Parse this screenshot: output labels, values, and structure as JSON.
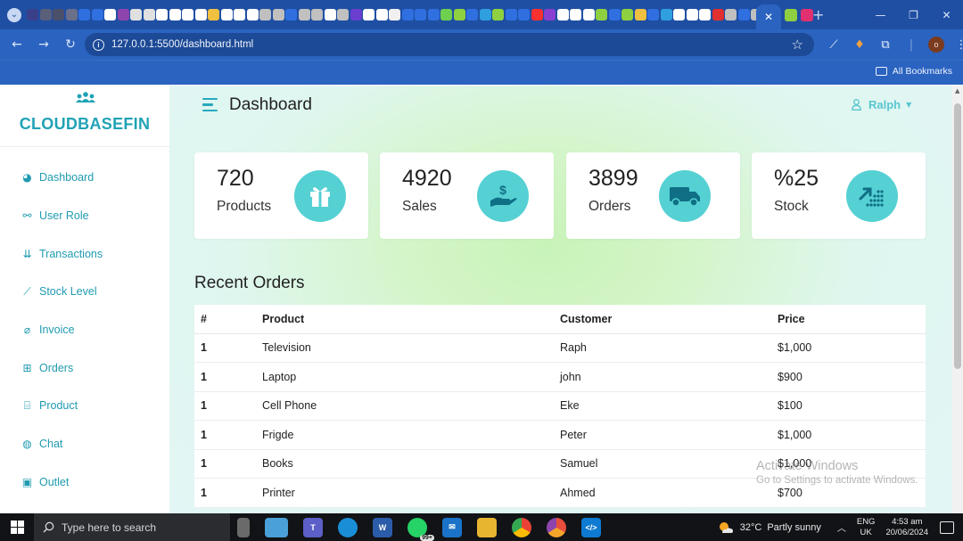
{
  "browser": {
    "url": "127.0.0.1:5500/dashboard.html",
    "all_bookmarks_label": "All Bookmarks",
    "profile_initial": "o",
    "tab_icon_colors": [
      "#3a3f8a",
      "#5a5f7a",
      "#4a4f6a",
      "#6a6f8a",
      "#2f6fe0",
      "#2f6fe0",
      "#ffffff",
      "#8e44ad",
      "#e0e0e0",
      "#e0e0e0",
      "#ffffff",
      "#ffffff",
      "#ffffff",
      "#ffffff",
      "#f0c040",
      "#ffffff",
      "#ffffff",
      "#ffffff",
      "#c0c0c0",
      "#c0c0c0",
      "#2f6fe0",
      "#c0c0c0",
      "#c0c0c0",
      "#ffffff",
      "#c0c0c0",
      "#6a3fd0",
      "#ffffff",
      "#ffffff",
      "#f0f0f0",
      "#2f6fe0",
      "#2f6fe0",
      "#2f6fe0",
      "#6fcf4f",
      "#8fd040",
      "#2f6fe0",
      "#2f9fe0",
      "#8fd040",
      "#2f6fe0",
      "#2f6fe0",
      "#ff3030",
      "#8a3fd0",
      "#ffffff",
      "#ffffff",
      "#ffffff",
      "#8fd040",
      "#2f6fe0",
      "#8fd040",
      "#f0c040",
      "#2f6fe0",
      "#2f9fe0",
      "#ffffff",
      "#ffffff",
      "#ffffff",
      "#e03030",
      "#c0c0c0",
      "#2f6fe0",
      "#c0c0c0"
    ]
  },
  "sidebar": {
    "brand": "CLOUDBASEFIN",
    "items": [
      {
        "label": "Dashboard",
        "icon": "dashboard-icon",
        "glyph": "◕"
      },
      {
        "label": "User Role",
        "icon": "user-role-icon",
        "glyph": "⚯"
      },
      {
        "label": "Transactions",
        "icon": "transactions-icon",
        "glyph": "⇊"
      },
      {
        "label": "Stock Level",
        "icon": "stock-level-icon",
        "glyph": "⟋"
      },
      {
        "label": "Invoice",
        "icon": "invoice-icon",
        "glyph": "⌀"
      },
      {
        "label": "Orders",
        "icon": "cart-icon",
        "glyph": "⊞"
      },
      {
        "label": "Product",
        "icon": "gift-icon",
        "glyph": "⌸"
      },
      {
        "label": "Chat",
        "icon": "chat-icon",
        "glyph": "◍"
      },
      {
        "label": "Outlet",
        "icon": "outlet-icon",
        "glyph": "▣"
      }
    ]
  },
  "header": {
    "title": "Dashboard",
    "user_name": "Ralph"
  },
  "cards": [
    {
      "value": "720",
      "label": "Products",
      "icon": "gift-icon"
    },
    {
      "value": "4920",
      "label": "Sales",
      "icon": "money-hand-icon"
    },
    {
      "value": "3899",
      "label": "Orders",
      "icon": "truck-icon"
    },
    {
      "value": "%25",
      "label": "Stock",
      "icon": "trend-icon"
    }
  ],
  "orders": {
    "title": "Recent Orders",
    "columns": [
      "#",
      "Product",
      "Customer",
      "Price"
    ],
    "rows": [
      [
        "1",
        "Television",
        "Raph",
        "$1,000"
      ],
      [
        "1",
        "Laptop",
        "john",
        "$900"
      ],
      [
        "1",
        "Cell Phone",
        "Eke",
        "$100"
      ],
      [
        "1",
        "Frigde",
        "Peter",
        "$1,000"
      ],
      [
        "1",
        "Books",
        "Samuel",
        "$1,000"
      ],
      [
        "1",
        "Printer",
        "Ahmed",
        "$700"
      ]
    ]
  },
  "watermark": {
    "title": "Activate Windows",
    "subtitle": "Go to Settings to activate Windows."
  },
  "taskbar": {
    "search_placeholder": "Type here to search",
    "whatsapp_badge": "99+",
    "temperature": "32°C",
    "weather": "Partly sunny",
    "lang_top": "ENG",
    "lang_bottom": "UK",
    "time": "4:53 am",
    "date": "20/06/2024"
  },
  "colors": {
    "accent": "#20a3b5",
    "icon_circle": "#55d0d3",
    "browser_dark": "#1f4fa3",
    "browser_toolbar": "#2b63c0"
  }
}
